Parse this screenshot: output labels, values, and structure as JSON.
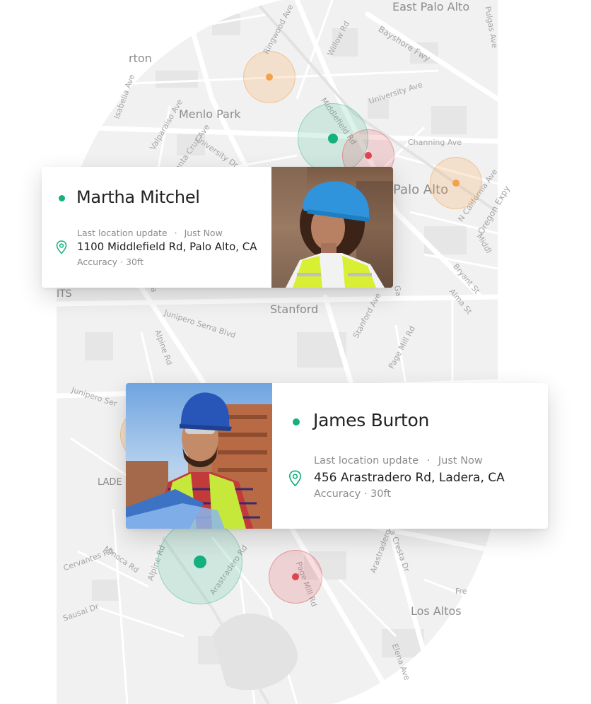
{
  "map": {
    "cities": {
      "east_palo_alto": "East Palo Alto",
      "menlo_park": "Menlo Park",
      "palo_alto": "Palo Alto",
      "stanford": "Stanford",
      "los_altos": "Los Altos",
      "atherton_partial": "rton",
      "ladera_partial": "LADE",
      "its_partial": "ITS"
    },
    "streets": {
      "willow": "Willow Rd",
      "bayshore": "Bayshore Fwy",
      "ringwood": "Ringwood Ave",
      "pulgas": "Pulgas Ave",
      "university": "University Ave",
      "isabella": "Isabella Ave",
      "valparaiso": "Valparaiso Ave",
      "santa_cruz": "Santa Cruz Ave",
      "university2": "University Dr",
      "middlefield": "Middlefield Rd",
      "channing": "Channing Ave",
      "california": "N California Ave",
      "oregon": "Oregon Expy",
      "middlefield2": "Middl",
      "bryant": "Bryant St",
      "alma": "Alma St",
      "junipero": "Junipero Serra Blvd",
      "alpine": "Alpine Rd",
      "stanford_ave": "Stanford Ave",
      "page_mill": "Page Mill Rd",
      "junipero2": "Junipero Ser",
      "cervantes": "Cervantes Rd",
      "minoca": "Minoca Rd",
      "alpine2": "Alpine Rd",
      "arastradero": "Arastradero Rd",
      "arastradero2": "Arastradero Rd",
      "la_cresta": "La Cresta Dr",
      "page_mill2": "Page Mill Rd",
      "saulsal": "Sausal Dr",
      "elena": "Elena Ave",
      "fre": "Fre",
      "sa": "Sa",
      "ga": "Ga"
    },
    "colors": {
      "green": "#14b07e",
      "orange": "#f5a04a",
      "red": "#e0444f"
    }
  },
  "cards": [
    {
      "name": "Martha Mitchel",
      "last_update_label": "Last location update",
      "separator": "·",
      "last_update_value": "Just Now",
      "address": "1100 Middlefield Rd, Palo Alto, CA",
      "accuracy": "Accuracy · 30ft",
      "status_color": "#14b07e",
      "pin_icon": "location-pin-icon"
    },
    {
      "name": "James Burton",
      "last_update_label": "Last location update",
      "separator": "·",
      "last_update_value": "Just Now",
      "address": "456 Arastradero Rd, Ladera, CA",
      "accuracy": "Accuracy · 30ft",
      "status_color": "#14b07e",
      "pin_icon": "location-pin-icon"
    }
  ]
}
